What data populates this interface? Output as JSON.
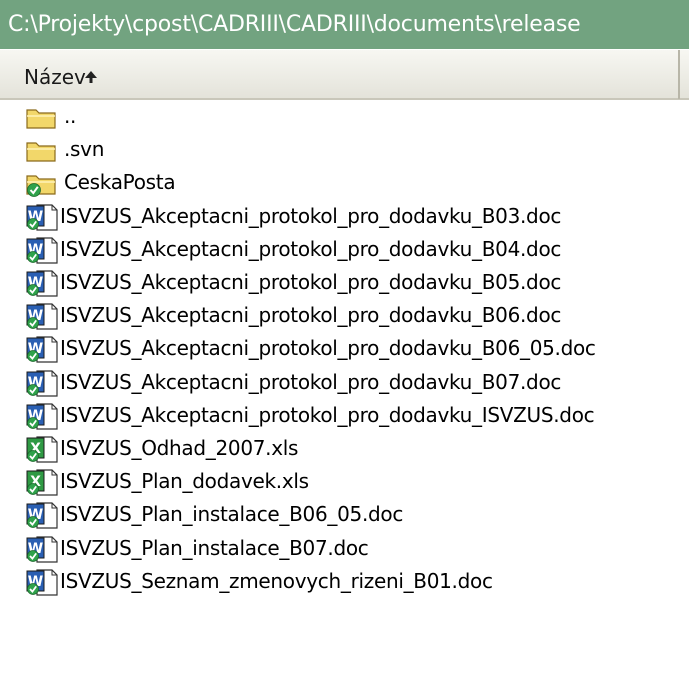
{
  "window": {
    "title": "C:\\Projekty\\cpost\\CADRIII\\CADRIII\\documents\\release"
  },
  "columns": {
    "name_label": "Název",
    "sort_icon": "sort-ascending-arrow-icon"
  },
  "colors": {
    "titlebar": "#72a380",
    "folder": "#f2d76a",
    "word_icon": "#2a5fb3",
    "excel_icon": "#2f9a44",
    "svn_badge": "#2fa24b"
  },
  "files": [
    {
      "name": "..",
      "icon": "folder-up-icon"
    },
    {
      "name": ".svn",
      "icon": "folder-icon"
    },
    {
      "name": "CeskaPosta",
      "icon": "svn-folder-icon"
    },
    {
      "name": "ISVZUS_Akceptacni_protokol_pro_dodavku_B03.doc",
      "icon": "word-document-icon"
    },
    {
      "name": "ISVZUS_Akceptacni_protokol_pro_dodavku_B04.doc",
      "icon": "word-document-icon"
    },
    {
      "name": "ISVZUS_Akceptacni_protokol_pro_dodavku_B05.doc",
      "icon": "word-document-icon"
    },
    {
      "name": "ISVZUS_Akceptacni_protokol_pro_dodavku_B06.doc",
      "icon": "word-document-icon"
    },
    {
      "name": "ISVZUS_Akceptacni_protokol_pro_dodavku_B06_05.doc",
      "icon": "word-document-icon"
    },
    {
      "name": "ISVZUS_Akceptacni_protokol_pro_dodavku_B07.doc",
      "icon": "word-document-icon"
    },
    {
      "name": "ISVZUS_Akceptacni_protokol_pro_dodavku_ISVZUS.doc",
      "icon": "word-document-icon"
    },
    {
      "name": "ISVZUS_Odhad_2007.xls",
      "icon": "excel-document-icon"
    },
    {
      "name": "ISVZUS_Plan_dodavek.xls",
      "icon": "excel-document-icon"
    },
    {
      "name": "ISVZUS_Plan_instalace_B06_05.doc",
      "icon": "word-document-icon"
    },
    {
      "name": "ISVZUS_Plan_instalace_B07.doc",
      "icon": "word-document-icon"
    },
    {
      "name": "ISVZUS_Seznam_zmenovych_rizeni_B01.doc",
      "icon": "word-document-icon"
    }
  ]
}
